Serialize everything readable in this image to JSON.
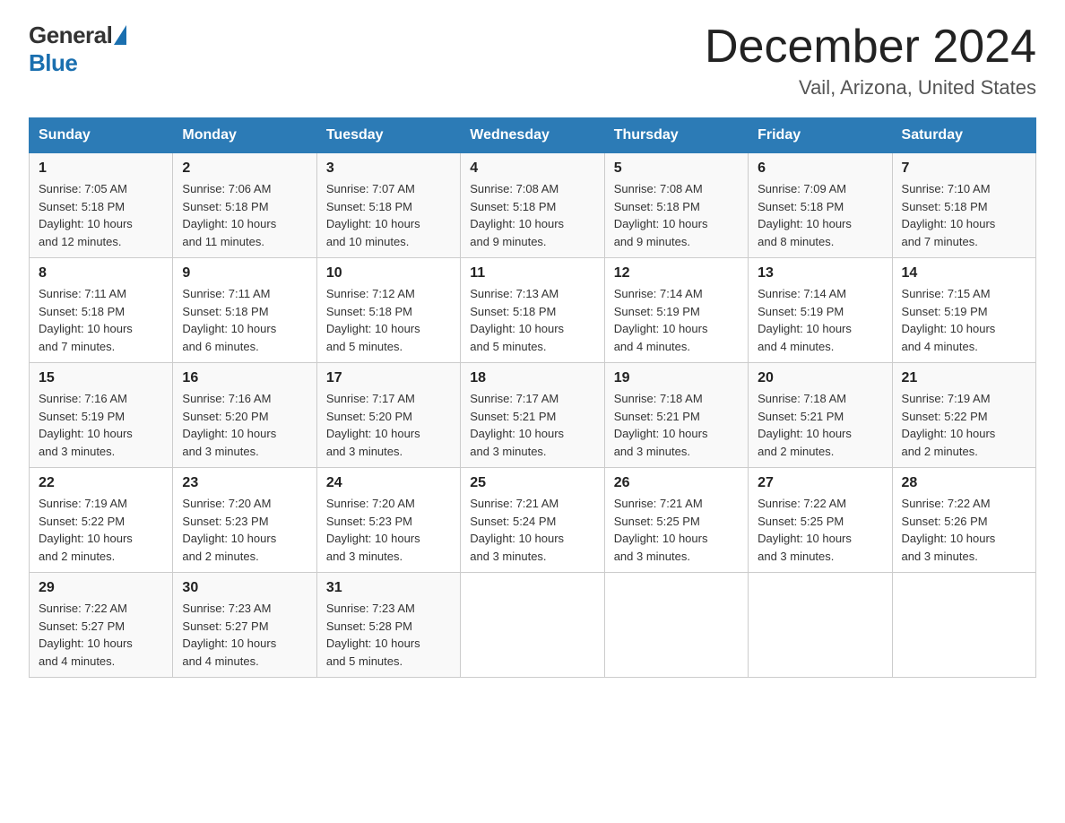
{
  "logo": {
    "general": "General",
    "blue": "Blue"
  },
  "title": "December 2024",
  "location": "Vail, Arizona, United States",
  "headers": [
    "Sunday",
    "Monday",
    "Tuesday",
    "Wednesday",
    "Thursday",
    "Friday",
    "Saturday"
  ],
  "weeks": [
    [
      {
        "day": "1",
        "sunrise": "7:05 AM",
        "sunset": "5:18 PM",
        "daylight": "10 hours and 12 minutes."
      },
      {
        "day": "2",
        "sunrise": "7:06 AM",
        "sunset": "5:18 PM",
        "daylight": "10 hours and 11 minutes."
      },
      {
        "day": "3",
        "sunrise": "7:07 AM",
        "sunset": "5:18 PM",
        "daylight": "10 hours and 10 minutes."
      },
      {
        "day": "4",
        "sunrise": "7:08 AM",
        "sunset": "5:18 PM",
        "daylight": "10 hours and 9 minutes."
      },
      {
        "day": "5",
        "sunrise": "7:08 AM",
        "sunset": "5:18 PM",
        "daylight": "10 hours and 9 minutes."
      },
      {
        "day": "6",
        "sunrise": "7:09 AM",
        "sunset": "5:18 PM",
        "daylight": "10 hours and 8 minutes."
      },
      {
        "day": "7",
        "sunrise": "7:10 AM",
        "sunset": "5:18 PM",
        "daylight": "10 hours and 7 minutes."
      }
    ],
    [
      {
        "day": "8",
        "sunrise": "7:11 AM",
        "sunset": "5:18 PM",
        "daylight": "10 hours and 7 minutes."
      },
      {
        "day": "9",
        "sunrise": "7:11 AM",
        "sunset": "5:18 PM",
        "daylight": "10 hours and 6 minutes."
      },
      {
        "day": "10",
        "sunrise": "7:12 AM",
        "sunset": "5:18 PM",
        "daylight": "10 hours and 5 minutes."
      },
      {
        "day": "11",
        "sunrise": "7:13 AM",
        "sunset": "5:18 PM",
        "daylight": "10 hours and 5 minutes."
      },
      {
        "day": "12",
        "sunrise": "7:14 AM",
        "sunset": "5:19 PM",
        "daylight": "10 hours and 4 minutes."
      },
      {
        "day": "13",
        "sunrise": "7:14 AM",
        "sunset": "5:19 PM",
        "daylight": "10 hours and 4 minutes."
      },
      {
        "day": "14",
        "sunrise": "7:15 AM",
        "sunset": "5:19 PM",
        "daylight": "10 hours and 4 minutes."
      }
    ],
    [
      {
        "day": "15",
        "sunrise": "7:16 AM",
        "sunset": "5:19 PM",
        "daylight": "10 hours and 3 minutes."
      },
      {
        "day": "16",
        "sunrise": "7:16 AM",
        "sunset": "5:20 PM",
        "daylight": "10 hours and 3 minutes."
      },
      {
        "day": "17",
        "sunrise": "7:17 AM",
        "sunset": "5:20 PM",
        "daylight": "10 hours and 3 minutes."
      },
      {
        "day": "18",
        "sunrise": "7:17 AM",
        "sunset": "5:21 PM",
        "daylight": "10 hours and 3 minutes."
      },
      {
        "day": "19",
        "sunrise": "7:18 AM",
        "sunset": "5:21 PM",
        "daylight": "10 hours and 3 minutes."
      },
      {
        "day": "20",
        "sunrise": "7:18 AM",
        "sunset": "5:21 PM",
        "daylight": "10 hours and 2 minutes."
      },
      {
        "day": "21",
        "sunrise": "7:19 AM",
        "sunset": "5:22 PM",
        "daylight": "10 hours and 2 minutes."
      }
    ],
    [
      {
        "day": "22",
        "sunrise": "7:19 AM",
        "sunset": "5:22 PM",
        "daylight": "10 hours and 2 minutes."
      },
      {
        "day": "23",
        "sunrise": "7:20 AM",
        "sunset": "5:23 PM",
        "daylight": "10 hours and 2 minutes."
      },
      {
        "day": "24",
        "sunrise": "7:20 AM",
        "sunset": "5:23 PM",
        "daylight": "10 hours and 3 minutes."
      },
      {
        "day": "25",
        "sunrise": "7:21 AM",
        "sunset": "5:24 PM",
        "daylight": "10 hours and 3 minutes."
      },
      {
        "day": "26",
        "sunrise": "7:21 AM",
        "sunset": "5:25 PM",
        "daylight": "10 hours and 3 minutes."
      },
      {
        "day": "27",
        "sunrise": "7:22 AM",
        "sunset": "5:25 PM",
        "daylight": "10 hours and 3 minutes."
      },
      {
        "day": "28",
        "sunrise": "7:22 AM",
        "sunset": "5:26 PM",
        "daylight": "10 hours and 3 minutes."
      }
    ],
    [
      {
        "day": "29",
        "sunrise": "7:22 AM",
        "sunset": "5:27 PM",
        "daylight": "10 hours and 4 minutes."
      },
      {
        "day": "30",
        "sunrise": "7:23 AM",
        "sunset": "5:27 PM",
        "daylight": "10 hours and 4 minutes."
      },
      {
        "day": "31",
        "sunrise": "7:23 AM",
        "sunset": "5:28 PM",
        "daylight": "10 hours and 5 minutes."
      },
      null,
      null,
      null,
      null
    ]
  ],
  "labels": {
    "sunrise": "Sunrise:",
    "sunset": "Sunset:",
    "daylight": "Daylight:"
  }
}
